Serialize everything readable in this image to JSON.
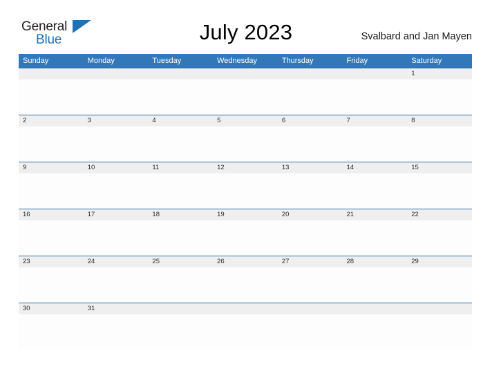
{
  "brand": {
    "word_one": "General",
    "word_two": "Blue",
    "triangle_icon": "triangle-icon",
    "accent_color": "#2271b3"
  },
  "header": {
    "title": "July 2023",
    "region": "Svalbard and Jan Mayen"
  },
  "calendar": {
    "month": "July",
    "year": "2023",
    "header_bg": "#3277b8",
    "row_line_color": "#2e6da4",
    "day_band_bg": "#efefef",
    "weekday_headers": [
      "Sunday",
      "Monday",
      "Tuesday",
      "Wednesday",
      "Thursday",
      "Friday",
      "Saturday"
    ],
    "weeks": [
      [
        "",
        "",
        "",
        "",
        "",
        "",
        "1"
      ],
      [
        "2",
        "3",
        "4",
        "5",
        "6",
        "7",
        "8"
      ],
      [
        "9",
        "10",
        "11",
        "12",
        "13",
        "14",
        "15"
      ],
      [
        "16",
        "17",
        "18",
        "19",
        "20",
        "21",
        "22"
      ],
      [
        "23",
        "24",
        "25",
        "26",
        "27",
        "28",
        "29"
      ],
      [
        "30",
        "31",
        "",
        "",
        "",
        "",
        ""
      ]
    ]
  }
}
